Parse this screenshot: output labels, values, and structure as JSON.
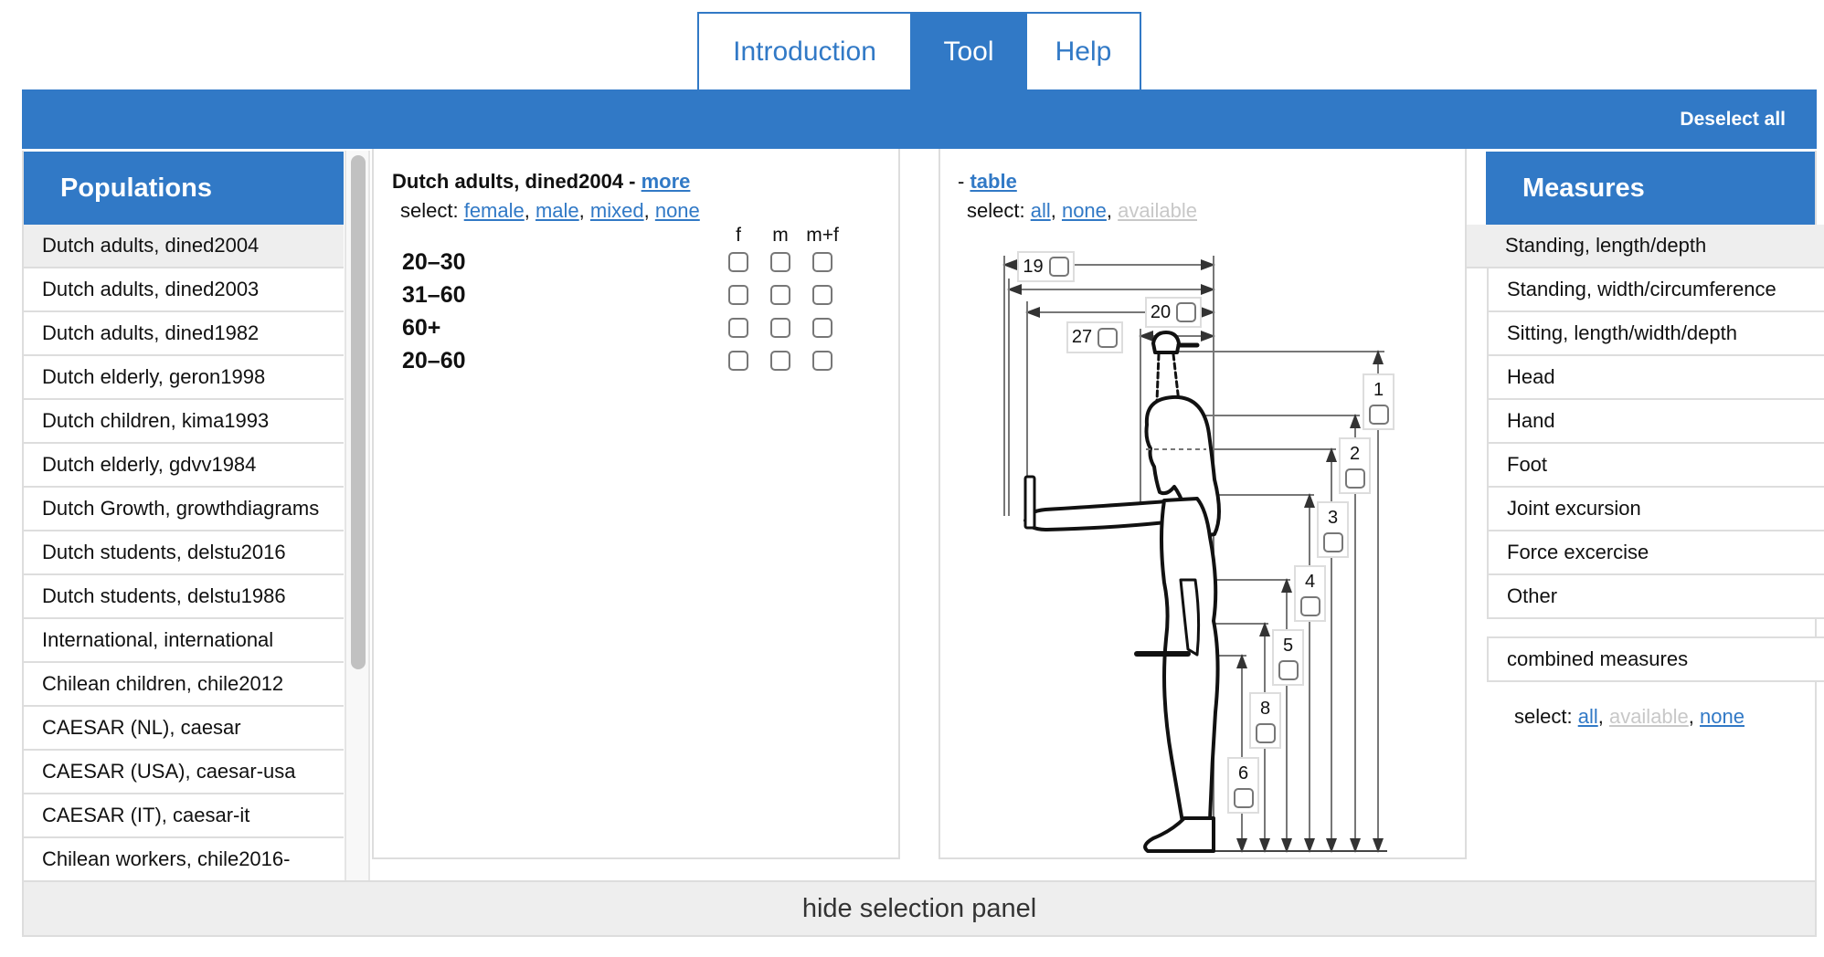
{
  "tabs": [
    {
      "label": "Introduction",
      "active": false
    },
    {
      "label": "Tool",
      "active": true
    },
    {
      "label": "Help",
      "active": false
    }
  ],
  "toolbar": {
    "deselect_all_label": "Deselect all"
  },
  "populations": {
    "title": "Populations",
    "items": [
      {
        "label": "Dutch adults, dined2004",
        "active": true
      },
      {
        "label": "Dutch adults, dined2003"
      },
      {
        "label": "Dutch adults, dined1982"
      },
      {
        "label": "Dutch elderly, geron1998"
      },
      {
        "label": "Dutch children, kima1993"
      },
      {
        "label": "Dutch elderly, gdvv1984"
      },
      {
        "label": "Dutch Growth, growthdiagrams"
      },
      {
        "label": "Dutch students, delstu2016"
      },
      {
        "label": "Dutch students, delstu1986"
      },
      {
        "label": "International, international"
      },
      {
        "label": "Chilean children, chile2012"
      },
      {
        "label": "CAESAR (NL), caesar"
      },
      {
        "label": "CAESAR (USA), caesar-usa"
      },
      {
        "label": "CAESAR (IT), caesar-it"
      },
      {
        "label": "Chilean workers, chile2016-"
      }
    ]
  },
  "dataset": {
    "title": "Dutch adults, dined2004",
    "separator": " - ",
    "more_label": "more",
    "select_prefix": "select: ",
    "select_links": [
      "female",
      "male",
      "mixed",
      "none"
    ],
    "columns": [
      "f",
      "m",
      "m+f"
    ],
    "age_groups": [
      "20–30",
      "31–60",
      "60+",
      "20–60"
    ],
    "checked": [
      [
        false,
        false,
        false
      ],
      [
        false,
        false,
        false
      ],
      [
        false,
        false,
        false
      ],
      [
        false,
        false,
        false
      ]
    ]
  },
  "figure": {
    "prefix": "- ",
    "table_label": "table",
    "select_prefix": "select: ",
    "select_links": [
      {
        "label": "all",
        "enabled": true
      },
      {
        "label": "none",
        "enabled": true
      },
      {
        "label": "available",
        "enabled": false
      }
    ],
    "measure_labels": [
      "19",
      "20",
      "27",
      "1",
      "2",
      "3",
      "4",
      "5",
      "8",
      "6"
    ]
  },
  "measures": {
    "title": "Measures",
    "items": [
      {
        "label": "Standing, length/depth",
        "active": true
      },
      {
        "label": "Standing, width/circumference"
      },
      {
        "label": "Sitting, length/width/depth"
      },
      {
        "label": "Head"
      },
      {
        "label": "Hand"
      },
      {
        "label": "Foot"
      },
      {
        "label": "Joint excursion"
      },
      {
        "label": "Force excercise"
      },
      {
        "label": "Other"
      }
    ],
    "combined_label": "combined measures",
    "select_prefix": "select: ",
    "select_links": [
      {
        "label": "all",
        "enabled": true
      },
      {
        "label": "available",
        "enabled": false
      },
      {
        "label": "none",
        "enabled": true
      }
    ]
  },
  "bottom": {
    "hide_panel_label": "hide selection panel"
  }
}
